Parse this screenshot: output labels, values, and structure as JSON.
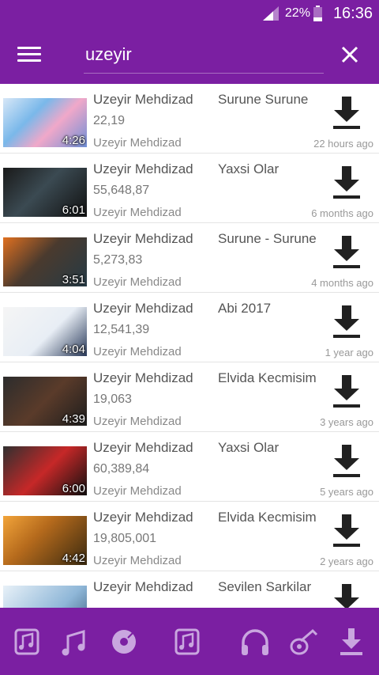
{
  "status_bar": {
    "battery_percent": "22%",
    "time": "16:36"
  },
  "search": {
    "value": "uzeyir"
  },
  "results": [
    {
      "artist": "Uzeyir Mehdizad",
      "song": "Surune Surune",
      "views": "22,19",
      "channel": "Uzeyir Mehdizad",
      "age": "22 hours ago",
      "duration": "4:26"
    },
    {
      "artist": "Uzeyir Mehdizad",
      "song": "Yaxsi Olar",
      "views": "55,648,87",
      "channel": "Uzeyir Mehdizad",
      "age": "6 months ago",
      "duration": "6:01"
    },
    {
      "artist": "Uzeyir Mehdizad",
      "song": "Surune - Surune",
      "views": "5,273,83",
      "channel": "Uzeyir Mehdizad",
      "age": "4 months ago",
      "duration": "3:51"
    },
    {
      "artist": "Uzeyir Mehdizad",
      "song": "Abi 2017",
      "views": "12,541,39",
      "channel": "Uzeyir Mehdizad",
      "age": "1 year ago",
      "duration": "4:04"
    },
    {
      "artist": "Uzeyir Mehdizad",
      "song": "Elvida Kecmisim",
      "views": "19,063",
      "channel": "Uzeyir Mehdizad",
      "age": "3 years ago",
      "duration": "4:39"
    },
    {
      "artist": "Uzeyir Mehdizad",
      "song": "Yaxsi Olar",
      "views": "60,389,84",
      "channel": "Uzeyir Mehdizad",
      "age": "5 years ago",
      "duration": "6:00"
    },
    {
      "artist": "Uzeyir Mehdizad",
      "song": "Elvida Kecmisim",
      "views": "19,805,001",
      "channel": "Uzeyir Mehdizad",
      "age": "2 years ago",
      "duration": "4:42"
    },
    {
      "artist": "Uzeyir Mehdizad",
      "song": "Sevilen Sarkilar",
      "views": "",
      "channel": "",
      "age": "",
      "duration": ""
    }
  ],
  "bottom_tabs": [
    "music-library-icon",
    "music-notes-icon",
    "music-disc-icon",
    "music-library-icon",
    "headphones-icon",
    "guitar-icon",
    "downloads-icon"
  ],
  "colors": {
    "primary": "#7b1fa2",
    "caret": "#e91e63"
  }
}
